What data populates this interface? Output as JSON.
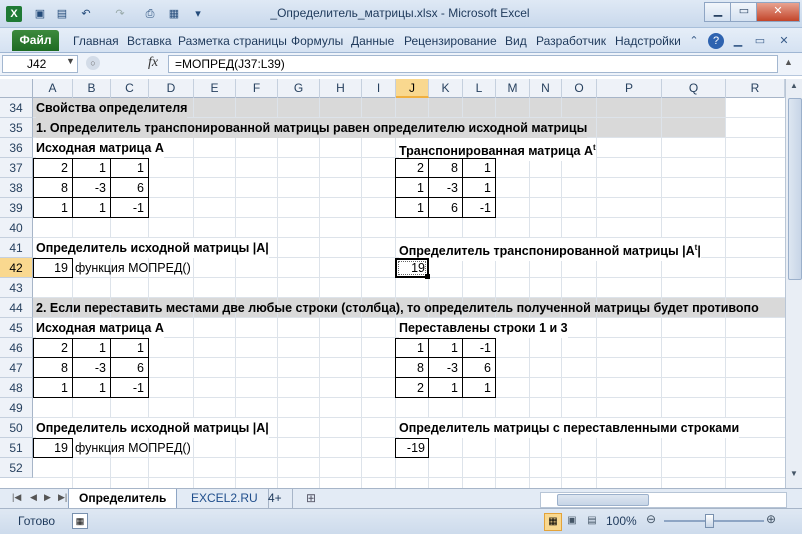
{
  "window": {
    "title": "_Определитель_матрицы.xlsx - Microsoft Excel"
  },
  "ribbon": {
    "file_tab": "Файл",
    "tabs": [
      "Главная",
      "Вставка",
      "Разметка страницы",
      "Формулы",
      "Данные",
      "Рецензирование",
      "Вид",
      "Разработчик",
      "Надстройки"
    ]
  },
  "formula_bar": {
    "name_box": "J42",
    "fx": "fx",
    "formula": "=МОПРЕД(J37:L39)"
  },
  "columns": [
    "A",
    "B",
    "C",
    "D",
    "E",
    "F",
    "G",
    "H",
    "I",
    "J",
    "K",
    "L",
    "M",
    "N",
    "O",
    "P",
    "Q",
    "R"
  ],
  "rows": [
    "34",
    "35",
    "36",
    "37",
    "38",
    "39",
    "40",
    "41",
    "42",
    "43",
    "44",
    "45",
    "46",
    "47",
    "48",
    "49",
    "50",
    "51",
    "52"
  ],
  "selected": {
    "column": "J",
    "row": "42"
  },
  "sheet": {
    "r34": "Свойства определителя",
    "r35": "1. Определитель транспонированной матрицы равен определителю исходной матрицы",
    "r36_left": "Исходная матрица А",
    "r36_right": "Транспонированная матрица А",
    "r36_right_sup": "t",
    "matrix1": [
      [
        "2",
        "1",
        "1"
      ],
      [
        "8",
        "-3",
        "6"
      ],
      [
        "1",
        "1",
        "-1"
      ]
    ],
    "matrix1_t": [
      [
        "2",
        "8",
        "1"
      ],
      [
        "1",
        "-3",
        "1"
      ],
      [
        "1",
        "6",
        "-1"
      ]
    ],
    "r41_left": "Определитель исходной матрицы  |А|",
    "r41_right": "Определитель транспонированной матрицы  |А",
    "r41_right_sup": "t",
    "r41_right_end": "|",
    "r42_value_left": "19",
    "r42_note_left": "функция МОПРЕД()",
    "r42_value_right": "19",
    "r44": "2. Если переставить местами две любые строки (столбца), то определитель полученной матрицы будет противопо",
    "r45_left": "Исходная матрица А",
    "r45_right": "Переставлены строки 1 и 3",
    "matrix2": [
      [
        "2",
        "1",
        "1"
      ],
      [
        "8",
        "-3",
        "6"
      ],
      [
        "1",
        "1",
        "-1"
      ]
    ],
    "matrix2_swapped": [
      [
        "1",
        "1",
        "-1"
      ],
      [
        "8",
        "-3",
        "6"
      ],
      [
        "2",
        "1",
        "1"
      ]
    ],
    "r50_left": "Определитель исходной матрицы  |А|",
    "r50_right": "Определитель матрицы с переставленными строками",
    "r51_value_left": "19",
    "r51_note_left": "функция МОПРЕД()",
    "r51_value_right": "-19"
  },
  "sheet_tabs": [
    "Определитель",
    "EXCEL2.RU",
    "4+"
  ],
  "status": {
    "ready": "Готово",
    "zoom": "100%"
  }
}
